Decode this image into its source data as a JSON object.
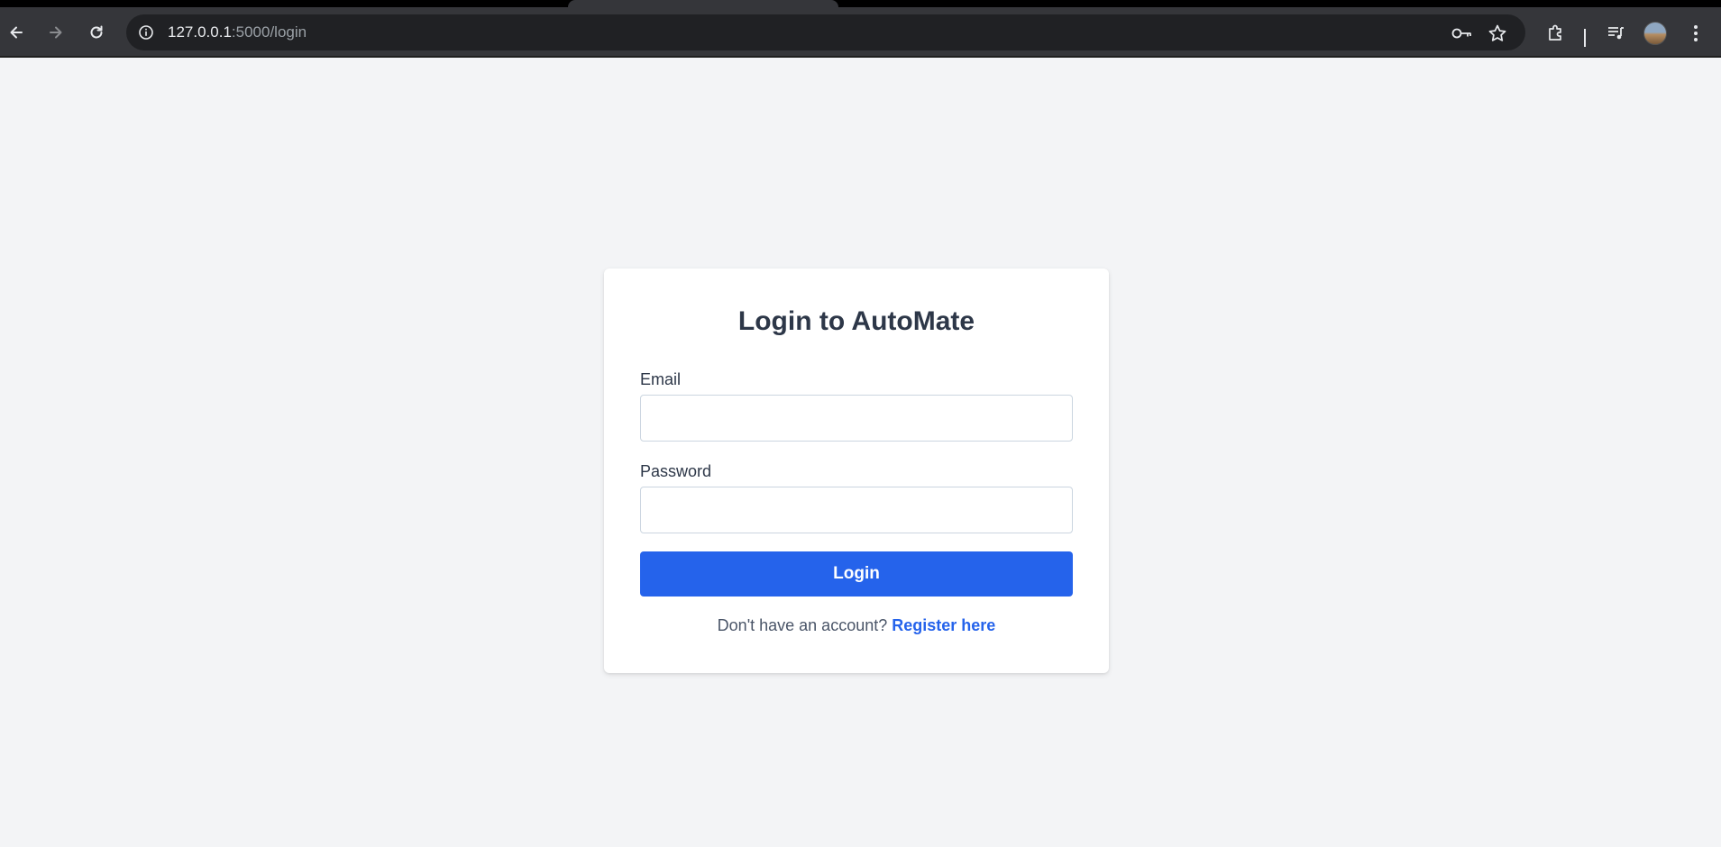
{
  "browser": {
    "url_host": "127.0.0.1",
    "url_path": ":5000/login",
    "icons": [
      "back-icon",
      "forward-icon",
      "reload-icon",
      "site-info-icon",
      "password-key-icon",
      "bookmark-star-icon",
      "extensions-icon",
      "media-queue-icon",
      "profile-avatar",
      "menu-kebab-icon"
    ],
    "colors": {
      "toolbar": "#35363a",
      "omnibox": "#202124"
    }
  },
  "login": {
    "title": "Login to AutoMate",
    "email_label": "Email",
    "email_value": "",
    "password_label": "Password",
    "password_value": "",
    "submit_label": "Login",
    "register_prompt": "Don't have an account?",
    "register_link": "Register here"
  },
  "colors": {
    "background": "#f3f4f6",
    "primary": "#2563eb",
    "heading": "#2d3748"
  }
}
